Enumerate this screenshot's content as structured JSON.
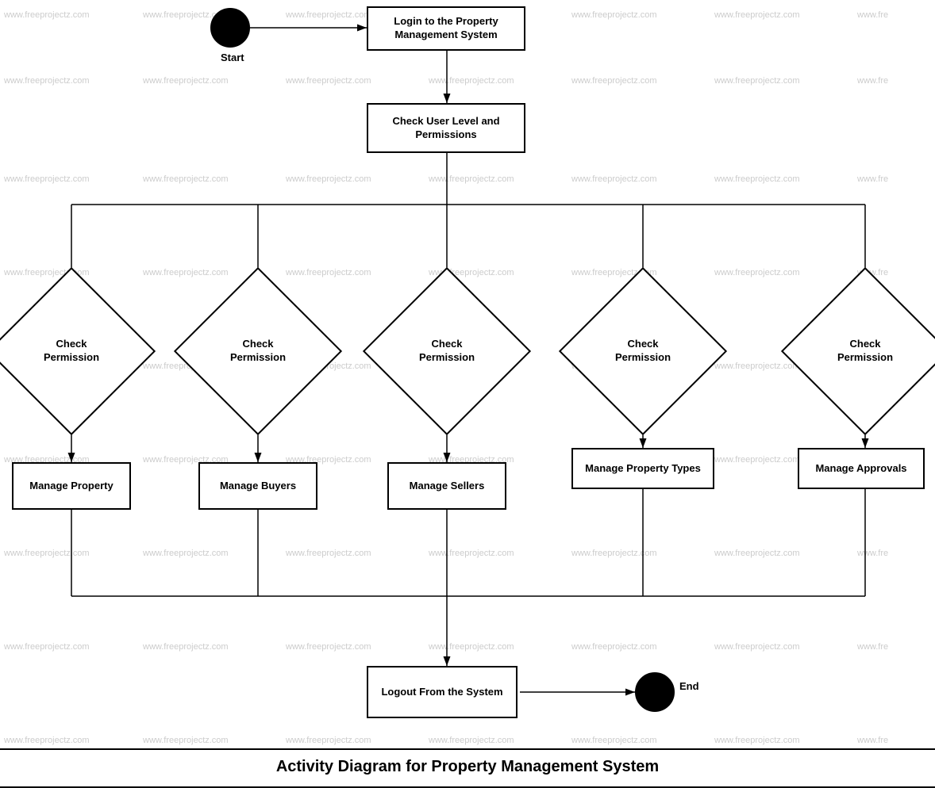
{
  "title": "Activity Diagram for Property Management System",
  "watermark": "www.freeprojectz.com",
  "nodes": {
    "start_label": "Start",
    "end_label": "End",
    "login": "Login to the Property\nManagement System",
    "check_user_level": "Check User Level and\nPermissions",
    "check_perm1": "Check\nPermission",
    "check_perm2": "Check\nPermission",
    "check_perm3": "Check\nPermission",
    "check_perm4": "Check\nPermission",
    "check_perm5": "Check\nPermission",
    "manage_property": "Manage Property",
    "manage_buyers": "Manage Buyers",
    "manage_sellers": "Manage Sellers",
    "manage_property_types": "Manage Property Types",
    "manage_approvals": "Manage Approvals",
    "logout": "Logout From the\nSystem"
  },
  "bottom_title": "Activity Diagram for Property Management System"
}
